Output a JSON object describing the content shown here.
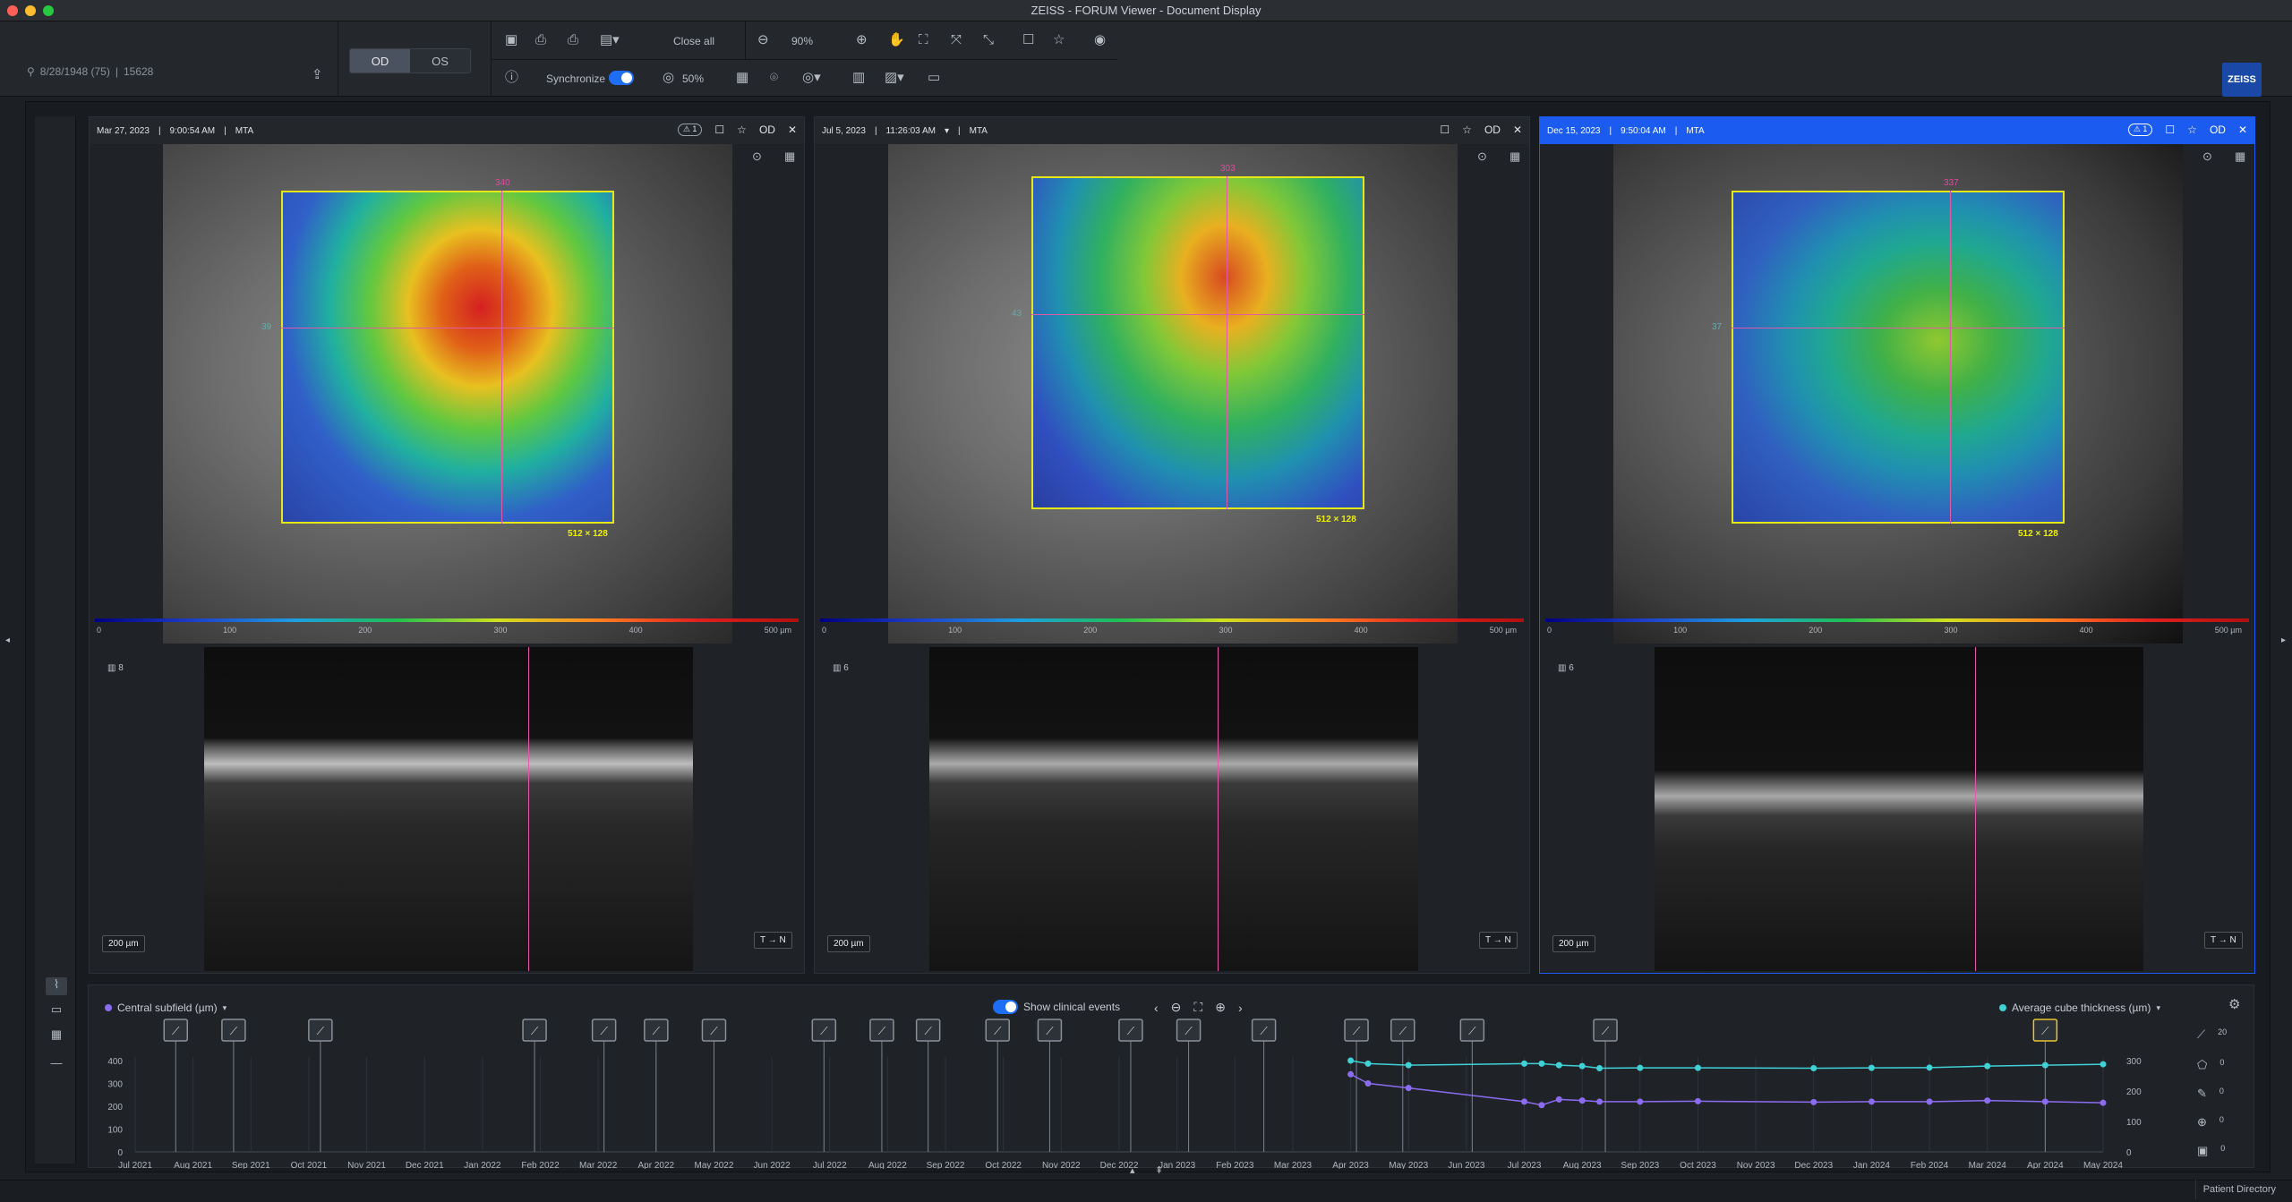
{
  "window": {
    "title": "ZEISS - FORUM Viewer - Document Display"
  },
  "patient": {
    "dob": "8/28/1948 (75)",
    "id": "15628"
  },
  "toolbar": {
    "eye_od": "OD",
    "eye_os": "OS",
    "close_all": "Close all",
    "zoom": "90%",
    "synchronize": "Synchronize",
    "opacity": "50%"
  },
  "logo": "ZEISS",
  "panels": [
    {
      "date": "Mar 27, 2023",
      "time": "9:00:54 AM",
      "mode": "MTA",
      "badge": "1",
      "eye": "OD",
      "top_val": "340",
      "left_val": "39",
      "size": "512 × 128",
      "bscan": "8",
      "scale": "200 µm",
      "tn": "T → N",
      "active": false
    },
    {
      "date": "Jul 5, 2023",
      "time": "11:26:03 AM",
      "mode": "MTA",
      "badge": "",
      "eye": "OD",
      "top_val": "303",
      "left_val": "43",
      "size": "512 × 128",
      "bscan": "6",
      "scale": "200 µm",
      "tn": "T → N",
      "active": false
    },
    {
      "date": "Dec 15, 2023",
      "time": "9:50:04 AM",
      "mode": "MTA",
      "badge": "1",
      "eye": "OD",
      "top_val": "337",
      "left_val": "37",
      "size": "512 × 128",
      "bscan": "6",
      "scale": "200 µm",
      "tn": "T → N",
      "active": true
    }
  ],
  "colorbar_ticks": [
    "0",
    "100",
    "200",
    "300",
    "400",
    "500 µm"
  ],
  "trend": {
    "left_legend": "Central subfield (µm)",
    "right_legend": "Average cube thickness (µm)",
    "show_events": "Show clinical events",
    "left_axis": [
      "400",
      "300",
      "200",
      "100",
      "0"
    ],
    "right_axis": [
      "300",
      "200",
      "100",
      "0"
    ],
    "months": [
      "Jul 2021",
      "Aug 2021",
      "Sep 2021",
      "Oct 2021",
      "Nov 2021",
      "Dec 2021",
      "Jan 2022",
      "Feb 2022",
      "Mar 2022",
      "Apr 2022",
      "May 2022",
      "Jun 2022",
      "Jul 2022",
      "Aug 2022",
      "Sep 2022",
      "Oct 2022",
      "Nov 2022",
      "Dec 2022",
      "Jan 2023",
      "Feb 2023",
      "Mar 2023",
      "Apr 2023",
      "May 2023",
      "Jun 2023",
      "Jul 2023",
      "Aug 2023",
      "Sep 2023",
      "Oct 2023",
      "Nov 2023",
      "Dec 2023",
      "Jan 2024",
      "Feb 2024",
      "Mar 2024",
      "Apr 2024",
      "May 2024"
    ],
    "right_tools": [
      "20",
      "0",
      "0",
      "0",
      "0"
    ]
  },
  "chart_data": {
    "type": "line",
    "x": [
      "Apr 2023",
      "Apr 2023",
      "May 2023",
      "Jul 2023",
      "Jul 2023",
      "Jul 2023",
      "Aug 2023",
      "Aug 2023",
      "Sep 2023",
      "Oct 2023",
      "Dec 2023",
      "Jan 2024",
      "Feb 2024",
      "Mar 2024",
      "Apr 2024",
      "May 2024"
    ],
    "series": [
      {
        "name": "Central subfield (µm)",
        "values": [
          340,
          300,
          280,
          220,
          205,
          230,
          225,
          220,
          220,
          222,
          218,
          220,
          220,
          225,
          220,
          215
        ]
      },
      {
        "name": "Average cube thickness (µm)",
        "values": [
          300,
          290,
          285,
          290,
          290,
          285,
          282,
          275,
          276,
          276,
          275,
          276,
          277,
          282,
          285,
          288
        ]
      }
    ],
    "ylim_left": [
      0,
      400
    ],
    "ylim_right": [
      0,
      300
    ]
  },
  "status": {
    "patient_directory": "Patient Directory"
  }
}
